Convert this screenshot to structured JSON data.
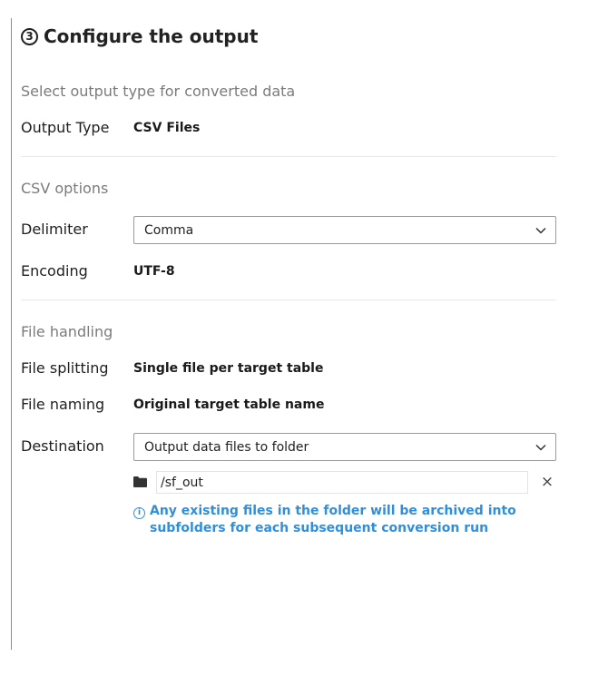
{
  "header": {
    "step_number": "3",
    "title": "Configure the output"
  },
  "output_section": {
    "heading": "Select output type for converted data",
    "output_type_label": "Output Type",
    "output_type_value": "CSV Files"
  },
  "csv_section": {
    "heading": "CSV options",
    "delimiter_label": "Delimiter",
    "delimiter_value": "Comma",
    "encoding_label": "Encoding",
    "encoding_value": "UTF-8"
  },
  "file_section": {
    "heading": "File handling",
    "splitting_label": "File splitting",
    "splitting_value": "Single file per target table",
    "naming_label": "File naming",
    "naming_value": "Original target table name",
    "destination_label": "Destination",
    "destination_value": "Output data files to folder",
    "folder_path": "/sf_out",
    "clear_symbol": "×",
    "info_message": "Any existing files in the folder will be archived into subfolders for each subsequent conversion run"
  },
  "icons": {
    "step": "circled-number-icon",
    "dropdown": "chevron-down-icon",
    "folder": "folder-icon",
    "clear": "close-icon",
    "info": "info-icon"
  },
  "colors": {
    "accent_info": "#2f8fdb",
    "section_heading": "#7b7b7b",
    "text": "#1f1f1f"
  }
}
